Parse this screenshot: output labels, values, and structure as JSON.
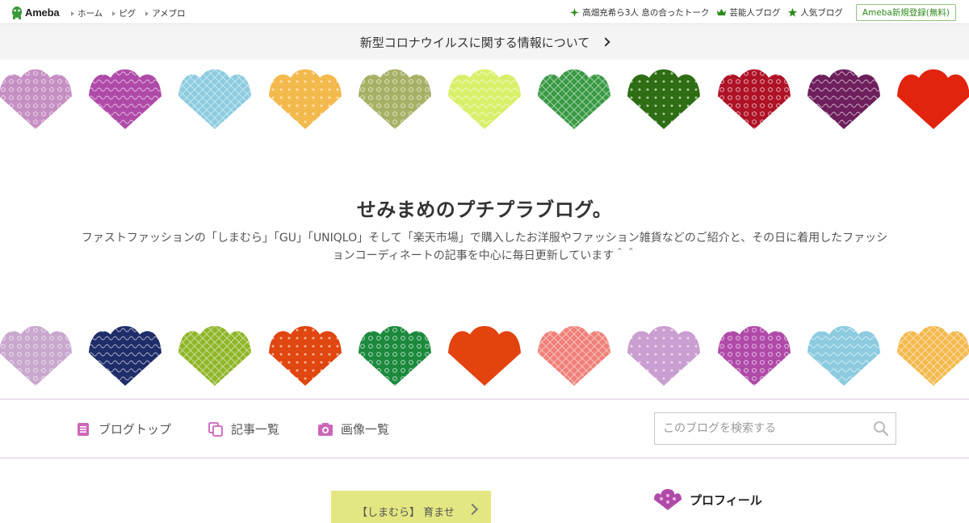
{
  "topbar": {
    "logo_text": "Ameba",
    "nav": [
      {
        "label": "ホーム"
      },
      {
        "label": "ピグ"
      },
      {
        "label": "アメブロ"
      }
    ],
    "links": [
      {
        "label": "高畑充希ら3人 息の合ったトーク",
        "icon": "sparkle-icon"
      },
      {
        "label": "芸能人ブログ",
        "icon": "crown-icon"
      },
      {
        "label": "人気ブログ",
        "icon": "star-icon"
      }
    ],
    "signup_label": "Ameba新規登録(無料)"
  },
  "notice": {
    "text": "新型コロナウイルスに関する情報について"
  },
  "blog": {
    "title": "せみまめのプチプラブログ。",
    "description": "ファストファッションの「しまむら」「GU」「UNIQLO」そして「楽天市場」で購入したお洋服やファッション雑貨などのご紹介と、その日に着用したファッションコーディネートの記事を中心に毎日更新しています＾＾"
  },
  "menu": {
    "items": [
      {
        "label": "ブログトップ",
        "icon": "document-icon"
      },
      {
        "label": "記事一覧",
        "icon": "copy-icon"
      },
      {
        "label": "画像一覧",
        "icon": "camera-icon"
      }
    ],
    "search_placeholder": "このブログを検索する"
  },
  "sidebar": {
    "profile_label": "プロフィール"
  },
  "feature": {
    "label": "【しまむら】 育ませ"
  },
  "colors": {
    "accent": "#cc66b8",
    "menu_border": "#e4c5e2",
    "notice_bg": "#f4f4f4",
    "ameba_green": "#2d8a1c",
    "feature_bg": "#e2e781"
  },
  "patterns_row1": [
    "#c68fc4",
    "#b04aa8",
    "#8ccbe0",
    "#f3b94c",
    "#a8b065",
    "#d8ef6a",
    "#3a9a44",
    "#2e6d14",
    "#b01226",
    "#6d1f5c",
    "#e2230e"
  ],
  "patterns_row2": [
    "#c9a7cf",
    "#1f2e6a",
    "#8fb628",
    "#e0460f",
    "#1c8a3d",
    "#e2430f",
    "#f08078",
    "#c99ed0",
    "#b04aa8",
    "#8ccbe0",
    "#f3b94c"
  ]
}
